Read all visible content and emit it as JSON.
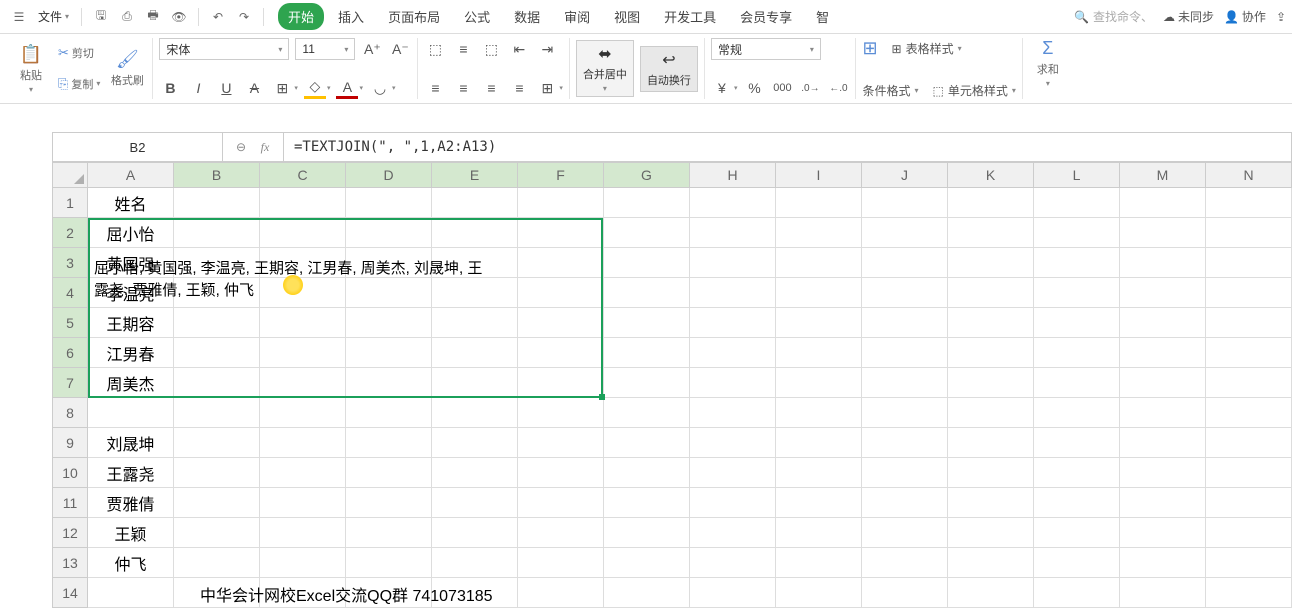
{
  "menubar": {
    "file": "文件",
    "search_placeholder": "查找命令、",
    "sync": "未同步",
    "collab": "协作",
    "tabs": [
      "开始",
      "插入",
      "页面布局",
      "公式",
      "数据",
      "审阅",
      "视图",
      "开发工具",
      "会员专享"
    ],
    "tab_trunc": "智"
  },
  "ribbon": {
    "paste": "粘贴",
    "cut": "剪切",
    "copy": "复制",
    "format_painter": "格式刷",
    "font_name": "宋体",
    "font_size": "11",
    "merge_center": "合并居中",
    "wrap_text": "自动换行",
    "num_format": "常规",
    "cond_fmt": "条件格式",
    "table_style": "表格样式",
    "cell_style": "单元格样式",
    "sum": "求和"
  },
  "formula_bar": {
    "name_box": "B2",
    "formula": "=TEXTJOIN(\", \",1,A2:A13)"
  },
  "columns": [
    "A",
    "B",
    "C",
    "D",
    "E",
    "F",
    "G",
    "H",
    "I",
    "J",
    "K",
    "L",
    "M",
    "N"
  ],
  "rows": [
    "1",
    "2",
    "3",
    "4",
    "5",
    "6",
    "7",
    "8",
    "9",
    "10",
    "11",
    "12",
    "13",
    "14"
  ],
  "data": {
    "A1": "姓名",
    "A2": "屈小怡",
    "A3": "黄国强",
    "A4": "李温亮",
    "A5": "王期容",
    "A6": "江男春",
    "A7": "周美杰",
    "A9": "刘晟坤",
    "A10": "王露尧",
    "A11": "贾雅倩",
    "A12": "王颖",
    "A13": "仲飞",
    "B2_text": "屈小怡, 黄国强, 李温亮, 王期容, 江男春, 周美杰, 刘晟坤, 王\n露尧, 贾雅倩, 王颖, 仲飞",
    "watermark": "中华会计网校Excel交流QQ群 741073185"
  }
}
